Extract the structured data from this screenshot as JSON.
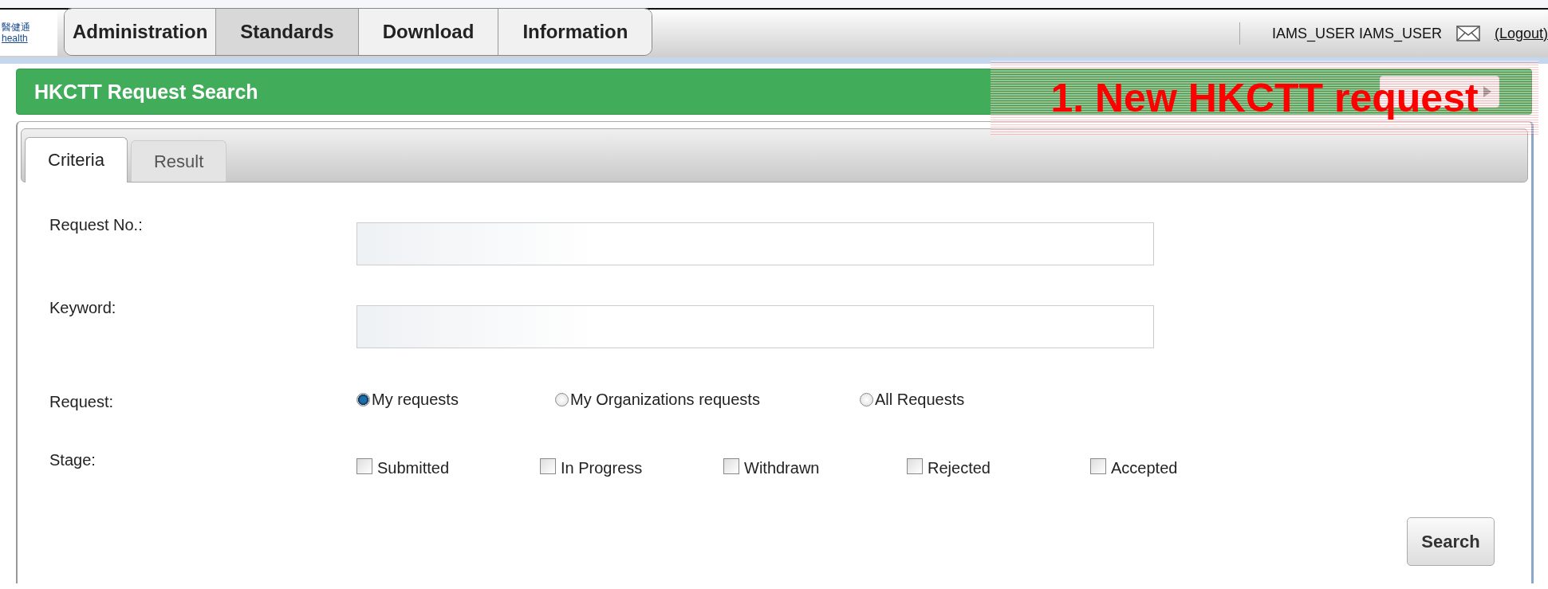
{
  "logo": {
    "top": "醫健通",
    "bottom": "health"
  },
  "nav": [
    {
      "label": "Administration",
      "selected": false
    },
    {
      "label": "Standards",
      "selected": true
    },
    {
      "label": "Download",
      "selected": false
    },
    {
      "label": "Information",
      "selected": false
    }
  ],
  "user": {
    "name": "IAMS_USER IAMS_USER",
    "logout": "(Logout)"
  },
  "header": {
    "title": "HKCTT Request Search"
  },
  "annotation": {
    "text": "1. New HKCTT request"
  },
  "tabs": [
    {
      "label": "Criteria",
      "selected": true
    },
    {
      "label": "Result",
      "selected": false
    }
  ],
  "form": [
    {
      "kind": "text",
      "label": "Request No.:"
    },
    {
      "kind": "text",
      "label": "Keyword:"
    },
    {
      "kind": "radio",
      "label": "Request:",
      "options": [
        {
          "label": "My requests",
          "selected": true
        },
        {
          "label": "My Organizations requests",
          "selected": false
        },
        {
          "label": "All Requests",
          "selected": false
        }
      ]
    },
    {
      "kind": "checkbox",
      "label": "Stage:",
      "options": [
        {
          "label": "Submitted",
          "checked": false
        },
        {
          "label": "In Progress",
          "checked": false
        },
        {
          "label": "Withdrawn",
          "checked": false
        },
        {
          "label": "Rejected",
          "checked": false
        },
        {
          "label": "Accepted",
          "checked": false
        }
      ]
    }
  ],
  "search_button": "Search"
}
